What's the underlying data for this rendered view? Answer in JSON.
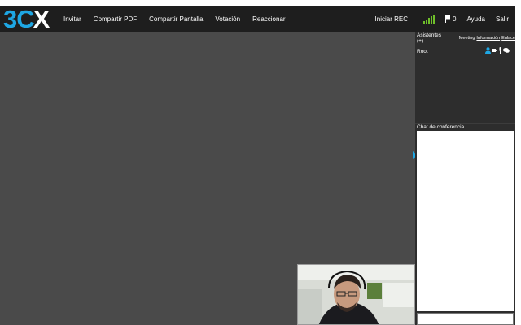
{
  "logo": {
    "three": "3",
    "c": "C",
    "x": "X"
  },
  "nav": {
    "invite": "Invitar",
    "share_pdf": "Compartir PDF",
    "share_screen": "Compartir Pantalla",
    "vote": "Votación",
    "react": "Reaccionar",
    "start_rec": "Iniciar REC",
    "flag_count": "0",
    "help": "Ayuda",
    "exit": "Salir"
  },
  "colors": {
    "accent": "#1ea7e4",
    "signal": "#6fbf2a",
    "topbar": "#1e1e1e",
    "stage": "#4a4a4a",
    "panel": "#2d2d2d"
  },
  "attendees": {
    "title": "Asistentes (+)",
    "links": {
      "meeting": "Meeting",
      "info": "Información",
      "link": "Enlace"
    },
    "items": [
      {
        "name": "Root",
        "icons": [
          "user-icon",
          "camera-icon",
          "microphone-icon",
          "chat-icon"
        ]
      }
    ]
  },
  "chat": {
    "title": "Chat de conferencia",
    "input_value": ""
  },
  "signal": {
    "level": 5,
    "max": 5
  }
}
